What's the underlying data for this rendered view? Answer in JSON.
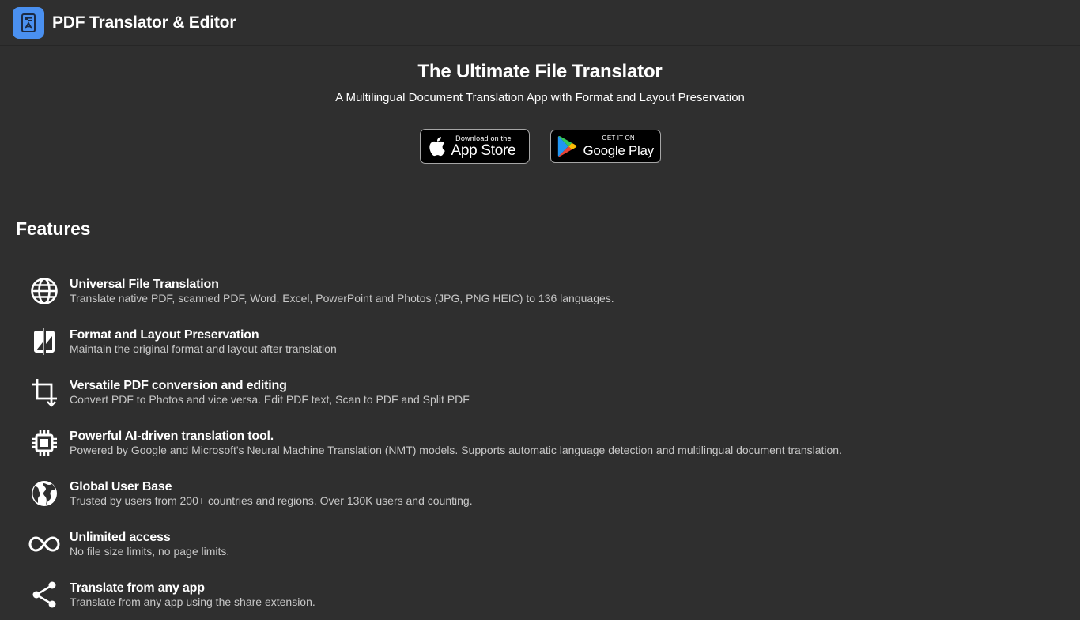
{
  "header": {
    "app_icon": "document-translate-icon",
    "title": "PDF Translator & Editor"
  },
  "hero": {
    "title": "The Ultimate File Translator",
    "subtitle": "A Multilingual Document Translation App with Format and Layout Preservation"
  },
  "badges": {
    "app_store": {
      "small": "Download on the",
      "big": "App Store",
      "icon": "apple-icon"
    },
    "google_play": {
      "small": "GET IT ON",
      "big": "Google Play",
      "icon": "google-play-icon"
    }
  },
  "features": {
    "heading": "Features",
    "items": [
      {
        "icon": "globe-icon",
        "title": "Universal File Translation",
        "desc": "Translate native PDF, scanned PDF, Word, Excel, PowerPoint and Photos (JPG, PNG HEIC) to 136 languages."
      },
      {
        "icon": "compare-icon",
        "title": "Format and Layout Preservation",
        "desc": "Maintain the original format and layout after translation"
      },
      {
        "icon": "crop-icon",
        "title": "Versatile PDF conversion and editing",
        "desc": "Convert PDF to Photos and vice versa. Edit PDF text, Scan to PDF and Split PDF"
      },
      {
        "icon": "chip-icon",
        "title": "Powerful AI-driven translation tool.",
        "desc": "Powered by Google and Microsoft's Neural Machine Translation (NMT) models. Supports automatic language detection and multilingual document translation."
      },
      {
        "icon": "public-globe-icon",
        "title": "Global User Base",
        "desc": "Trusted by users from 200+ countries and regions. Over 130K users and counting."
      },
      {
        "icon": "infinity-icon",
        "title": "Unlimited access",
        "desc": "No file size limits, no page limits."
      },
      {
        "icon": "share-icon",
        "title": "Translate from any app",
        "desc": "Translate from any app using the share extension."
      }
    ]
  }
}
